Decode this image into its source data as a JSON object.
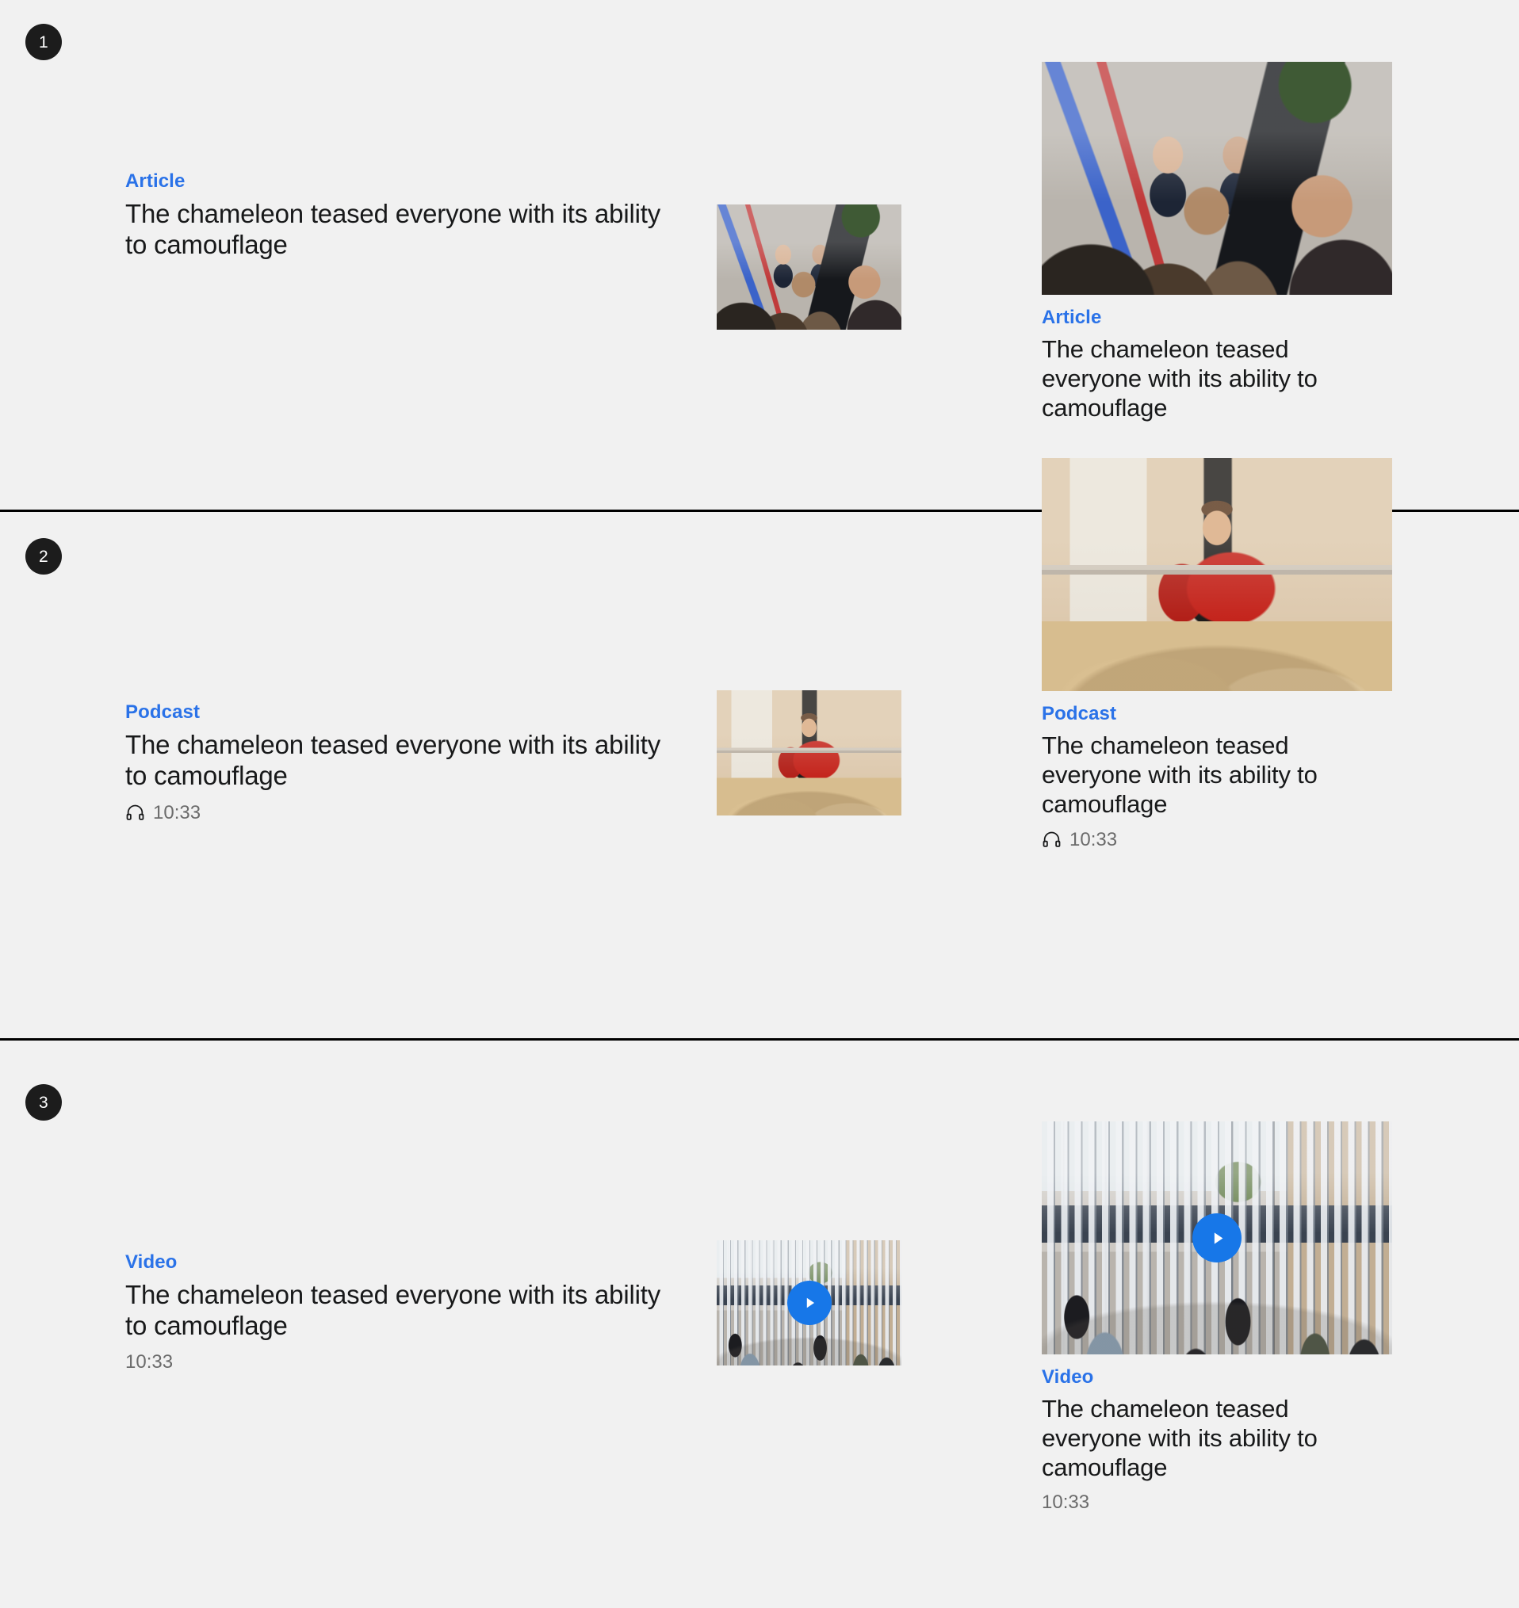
{
  "page": {
    "background_color": "#f1f1f1",
    "accent_color": "#2a72e8",
    "badge_color": "#1c1c1c",
    "divider_color": "#000000",
    "meta_text_color": "#6b6b6b"
  },
  "sections": [
    {
      "badge": "1",
      "left_card": {
        "kicker": "Article",
        "headline": "The chameleon teased everyone with its ability to camouflage",
        "duration": null,
        "has_headphone_icon": false,
        "has_play_button": false,
        "image_name": "press-scrum-photo"
      },
      "right_card": {
        "kicker": "Article",
        "headline": "The chameleon teased everyone with its ability to camouflage",
        "duration": null,
        "has_headphone_icon": false,
        "has_play_button": false,
        "image_name": "press-scrum-photo"
      }
    },
    {
      "badge": "2",
      "left_card": {
        "kicker": "Podcast",
        "headline": "The chameleon teased everyone with its ability to camouflage",
        "duration": "10:33",
        "has_headphone_icon": true,
        "has_play_button": false,
        "image_name": "courtroom-judge-photo"
      },
      "right_card": {
        "kicker": "Podcast",
        "headline": "The chameleon teased everyone with its ability to camouflage",
        "duration": "10:33",
        "has_headphone_icon": true,
        "has_play_button": false,
        "image_name": "courtroom-judge-photo"
      }
    },
    {
      "badge": "3",
      "left_card": {
        "kicker": "Video",
        "headline": "The chameleon teased everyone with its ability to camouflage",
        "duration": "10:33",
        "has_headphone_icon": false,
        "has_play_button": true,
        "image_name": "street-protest-photo"
      },
      "right_card": {
        "kicker": "Video",
        "headline": "The chameleon teased everyone with its ability to camouflage",
        "duration": "10:33",
        "has_headphone_icon": false,
        "has_play_button": true,
        "image_name": "street-protest-photo"
      }
    }
  ]
}
